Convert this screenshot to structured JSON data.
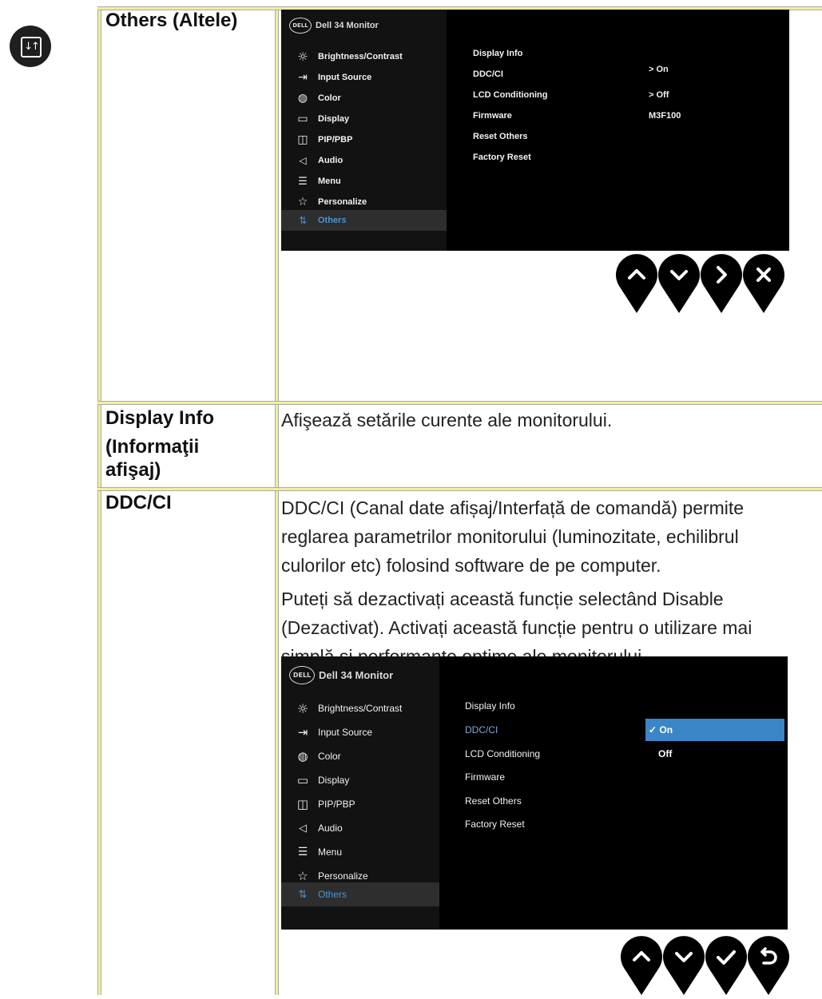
{
  "section": {
    "icon": "others-icon",
    "title": "Others (Altele)"
  },
  "rows": [
    {
      "head": [
        "Display Info",
        "(Informaţii",
        "afişaj)"
      ],
      "desc": [
        "Afişează setările curente ale monitorului."
      ]
    },
    {
      "head": [
        "DDC/CI"
      ],
      "desc": [
        "DDC/CI (Canal date afișaj/Interfață de comandă) permite",
        "reglarea parametrilor monitorului (luminozitate, echilibrul",
        "culorilor etc) folosind software de pe computer.",
        "Puteți să dezactivați această funcție selectând Disable",
        "(Dezactivat). Activați această funcție pentru o utilizare mai",
        "simplă şi performanțe optime ale monitorului."
      ]
    }
  ],
  "osd1": {
    "logo": "DELL",
    "model": "Dell 34 Monitor",
    "menu": [
      {
        "icon": "brightness-icon",
        "glyph": "☼",
        "label": "Brightness/Contrast"
      },
      {
        "icon": "input-source-icon",
        "glyph": "⇥",
        "label": "Input Source"
      },
      {
        "icon": "color-icon",
        "glyph": "◍",
        "label": "Color"
      },
      {
        "icon": "display-icon",
        "glyph": "▭",
        "label": "Display"
      },
      {
        "icon": "pip-pbp-icon",
        "glyph": "◫",
        "label": "PIP/PBP"
      },
      {
        "icon": "audio-icon",
        "glyph": "◁",
        "label": "Audio"
      },
      {
        "icon": "menu-icon",
        "glyph": "☰",
        "label": "Menu"
      },
      {
        "icon": "personalize-icon",
        "glyph": "☆",
        "label": "Personalize"
      },
      {
        "icon": "others-icon",
        "glyph": "⇅",
        "label": "Others"
      }
    ],
    "items": [
      {
        "label": "Display Info",
        "value": ""
      },
      {
        "label": "DDC/CI",
        "value": "> On"
      },
      {
        "label": "LCD Conditioning",
        "value": "> Off"
      },
      {
        "label": "Firmware",
        "value": "M3F100"
      },
      {
        "label": "Reset Others",
        "value": ""
      },
      {
        "label": "Factory Reset",
        "value": ""
      }
    ],
    "buttons": [
      "up-icon",
      "down-icon",
      "right-icon",
      "close-icon"
    ]
  },
  "osd2": {
    "logo": "DELL",
    "model": "Dell 34 Monitor",
    "options": [
      "✓ On",
      "Off"
    ],
    "buttons": [
      "up-icon",
      "down-icon",
      "check-icon",
      "back-icon"
    ]
  }
}
